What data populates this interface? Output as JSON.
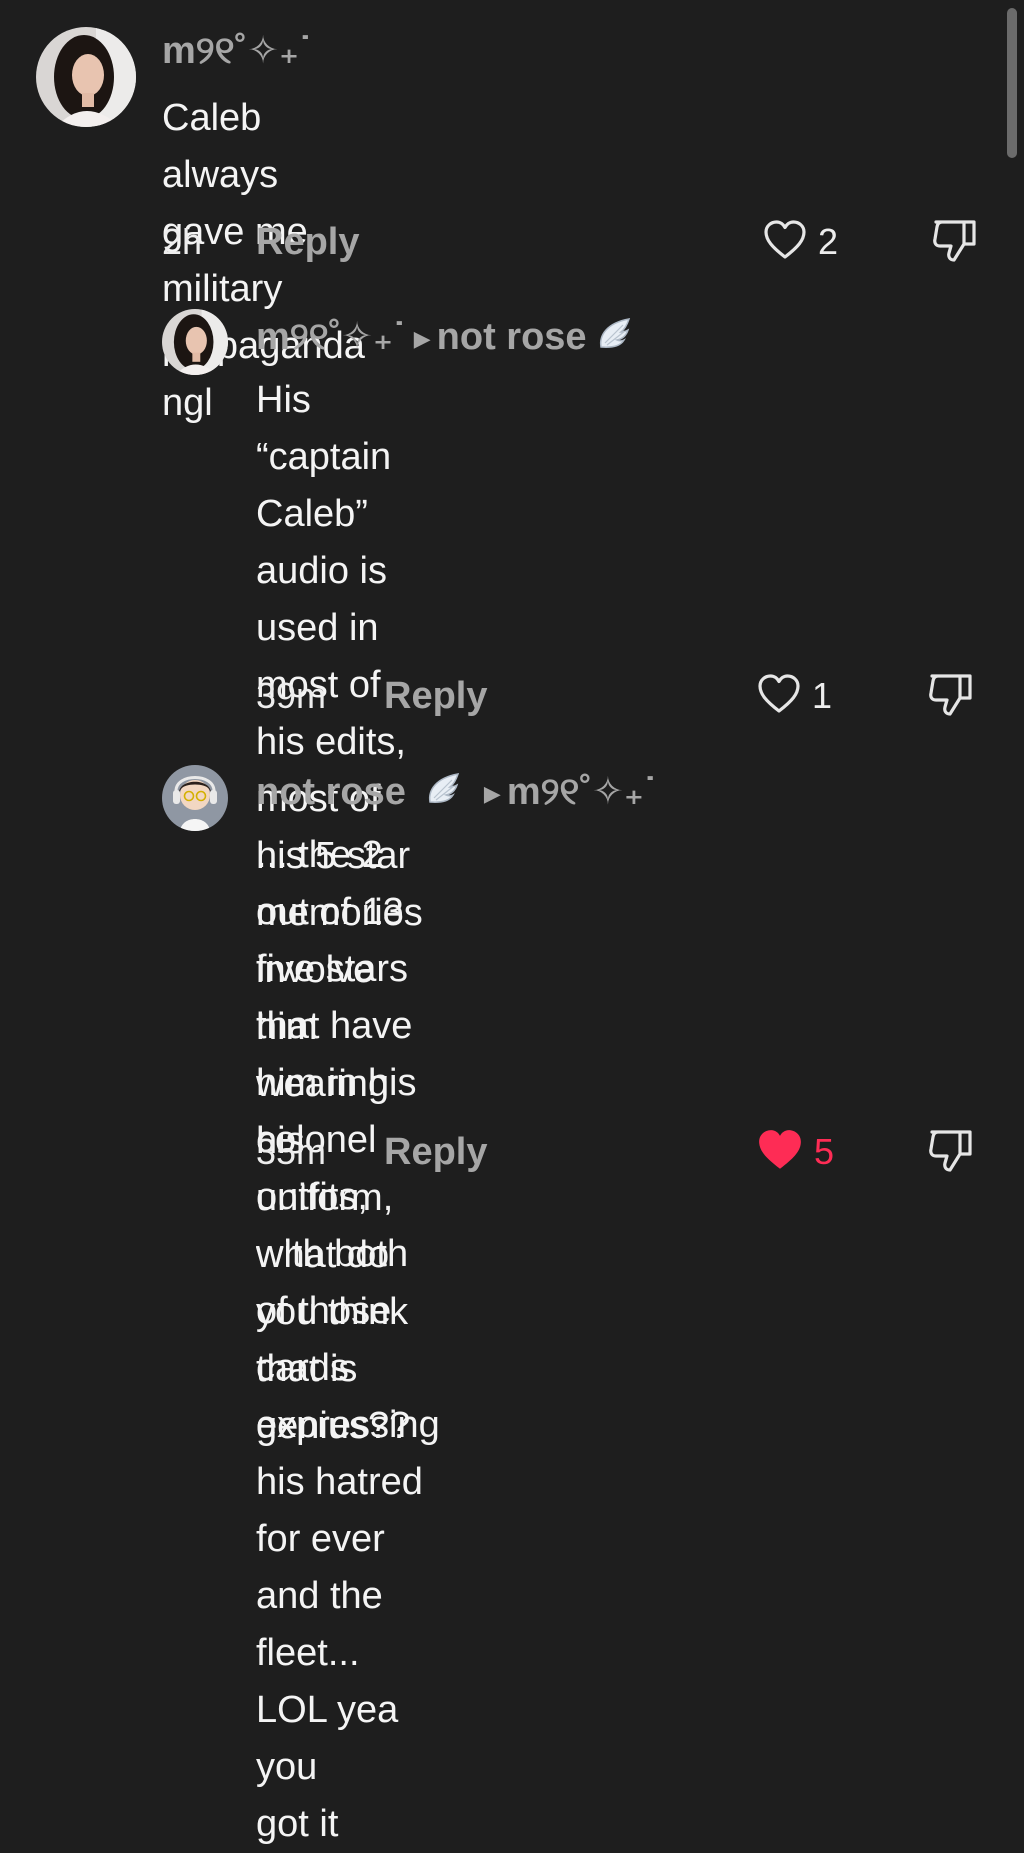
{
  "comments": [
    {
      "author": "m୨୧˚✧₊˙",
      "text": "Caleb always gave me military\npropaganda ngl",
      "time": "2h",
      "reply_label": "Reply",
      "likes": "2",
      "liked": false
    },
    {
      "author": "m୨୧˚✧₊˙",
      "reply_to": "not rose",
      "text": "His “captain Caleb” audio is used in\nmost of his edits, most of his 5 star\nmemories involve him wearing his\nuniform, what do you think that is\ngenius??",
      "time": "39m",
      "reply_label": "Reply",
      "likes": "1",
      "liked": false
    },
    {
      "author": "not rose",
      "reply_to": "m୨୧˚✧₊˙",
      "text": "... the 2 out of 13 five stars that have\nhim in his colonel outfits, with both\nof those cards expressing his hatred\nfor ever and the fleet... LOL yea you\ngot it",
      "time": "35m",
      "reply_label": "Reply",
      "likes": "5",
      "liked": true
    }
  ],
  "colors": {
    "background": "#1e1e1e",
    "muted_text": "#a6a6a6",
    "liked_heart": "#fe2c55"
  },
  "icons": {
    "like": "heart-outline-icon",
    "liked": "heart-filled-icon",
    "dislike": "thumbs-down-icon",
    "badge": "angel-wing-icon",
    "reply_arrow": "play-arrow-icon"
  }
}
